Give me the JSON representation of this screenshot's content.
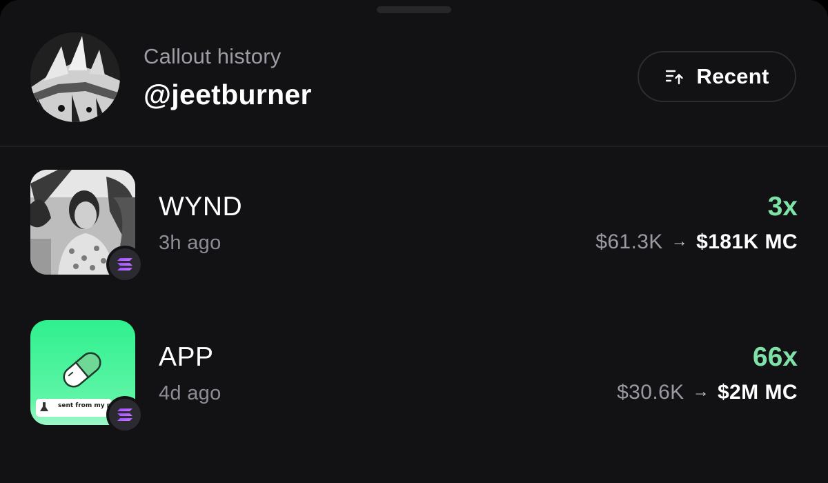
{
  "header": {
    "subtitle": "Callout history",
    "username": "@jeetburner",
    "sort_label": "Recent",
    "sort_icon": "sort-ascending-icon"
  },
  "callouts": [
    {
      "ticker": "WYND",
      "time_ago": "3h ago",
      "multiplier": "3x",
      "mc_from": "$61.3K",
      "arrow": "→",
      "mc_to": "$181K",
      "mc_unit": "MC",
      "chain_icon": "solana-icon"
    },
    {
      "ticker": "APP",
      "time_ago": "4d ago",
      "multiplier": "66x",
      "mc_from": "$30.6K",
      "arrow": "→",
      "mc_to": "$2M",
      "mc_unit": "MC",
      "chain_icon": "solana-icon",
      "image_caption": "sent from my pump"
    }
  ],
  "colors": {
    "background": "#121215",
    "gain": "#7ee2a8",
    "app_icon_green": "#2ff08f"
  }
}
